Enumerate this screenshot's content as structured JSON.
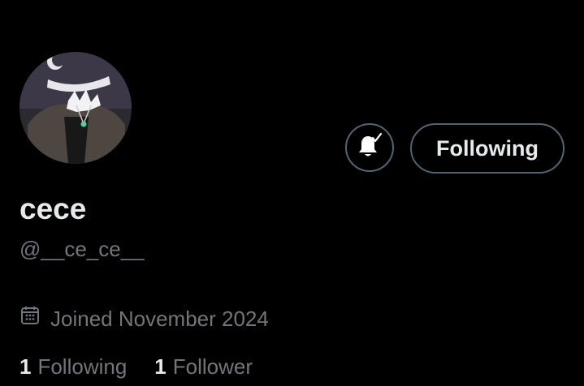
{
  "profile": {
    "display_name": "cece",
    "handle": "@__ce_ce__",
    "joined": "Joined November 2024",
    "avatar_icon": "profile-avatar-image"
  },
  "actions": {
    "notification_icon": "bell-check-icon",
    "follow_label": "Following"
  },
  "stats": {
    "following_count": "1",
    "following_label": "Following",
    "followers_count": "1",
    "followers_label": "Follower"
  },
  "colors": {
    "background": "#000000",
    "primary_text": "#e7e9ea",
    "secondary_text": "#71767b",
    "border": "#536471"
  }
}
